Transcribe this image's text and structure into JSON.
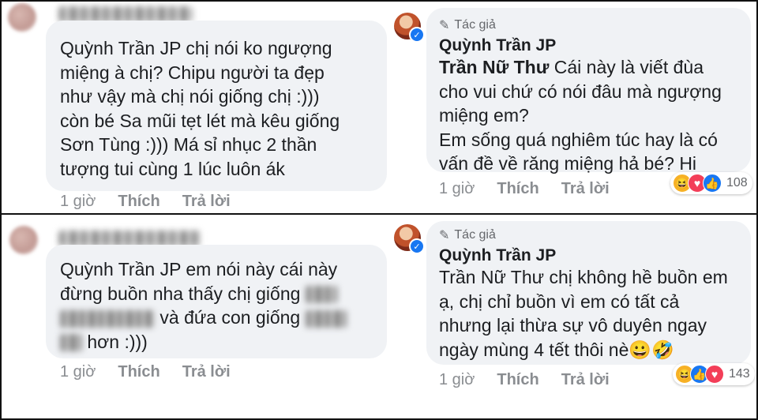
{
  "panels": [
    {
      "left": {
        "text_parts": [
          "Quỳnh Trần JP chị nói ko ngượng\nmiệng à chị? Chipu người ta đẹp\nnhư vậy mà chị nói giống chị :)))\ncòn bé Sa mũi tẹt lét mà kêu giống\nSơn Tùng :))) Má sỉ nhục 2 thần\ntượng tui cùng 1 lúc luôn ák"
        ],
        "time": "1 giờ",
        "like": "Thích",
        "reply": "Trả lời"
      },
      "right": {
        "author_tag": "Tác giả",
        "name": "Quỳnh Trần JP",
        "mention": "Trần Nữ Thư",
        "text": " Cái này là viết đùa\ncho vui chứ có nói đâu mà ngượng\nmiệng em?\nEm sống quá nghiêm túc hay là có\nvấn đề về răng miệng hả bé? Hi",
        "time": "1 giờ",
        "like": "Thích",
        "reply": "Trả lời",
        "reaction_count": "108"
      }
    },
    {
      "left": {
        "line1": "Quỳnh Trần JP em nói này cái này",
        "line2": "đừng buồn nha thấy chị giống",
        "line3": "và đứa con giống",
        "line4": "hơn :)))",
        "time": "1 giờ",
        "like": "Thích",
        "reply": "Trả lời"
      },
      "right": {
        "author_tag": "Tác giả",
        "name": "Quỳnh Trần JP",
        "text": "Trần Nữ Thư chị không hề buồn em\nạ, chị chỉ buồn vì em có tất cả\nnhưng lại thừa sự vô duyên ngay\nngày mùng 4 tết thôi nè",
        "emoji": "😀🤣",
        "time": "1 giờ",
        "like": "Thích",
        "reply": "Trả lời",
        "reaction_count": "143"
      }
    }
  ],
  "icons": {
    "author": "pencil-icon",
    "verified": "check-icon",
    "haha": "haha-icon",
    "love": "heart-icon",
    "like": "thumbs-up-icon"
  },
  "colors": {
    "bubble": "#f0f2f5",
    "like_blue": "#1877f2",
    "love_red": "#f33e58",
    "haha_yellow": "#f7b125"
  }
}
